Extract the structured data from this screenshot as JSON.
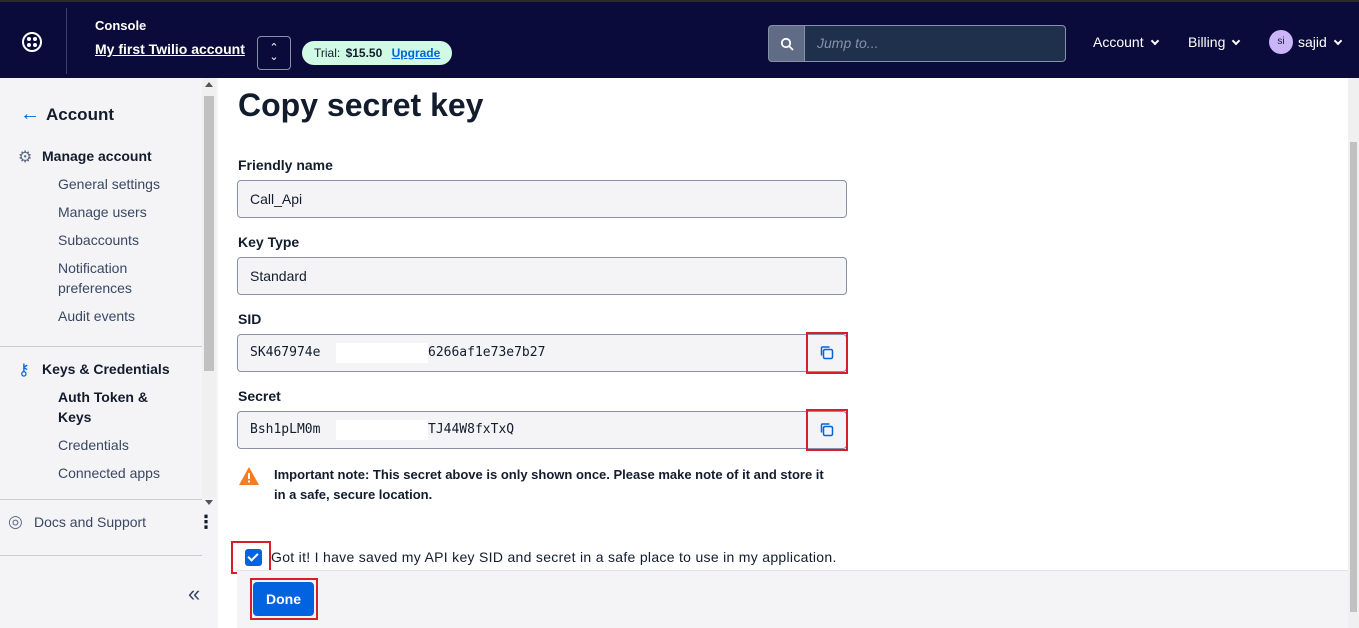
{
  "header": {
    "console_label": "Console",
    "account_name": "My first Twilio account",
    "trial_label": "Trial:",
    "trial_amount": "$15.50",
    "upgrade_label": "Upgrade",
    "search_placeholder": "Jump to...",
    "account_menu": "Account",
    "billing_menu": "Billing",
    "avatar_initials": "si",
    "user_name": "sajid"
  },
  "sidebar": {
    "back_label": "Account",
    "manage_account_section": "Manage account",
    "manage_items": [
      "General settings",
      "Manage users",
      "Subaccounts",
      "Notification preferences",
      "Audit events"
    ],
    "keys_section": "Keys & Credentials",
    "keys_items": [
      "Auth Token & Keys",
      "Credentials",
      "Connected apps"
    ],
    "docs_label": "Docs and Support",
    "collapse_icon": "double-chevron-left-icon"
  },
  "main": {
    "title": "Copy secret key",
    "friendly_name_label": "Friendly name",
    "friendly_name_value": "Call_Api",
    "key_type_label": "Key Type",
    "key_type_value": "Standard",
    "sid_label": "SID",
    "sid_value_start": "SK467974e",
    "sid_value_end": "6266af1e73e7b27",
    "secret_label": "Secret",
    "secret_value_start": "Bsh1pLM0m",
    "secret_value_end": "TJ44W8fxTxQ",
    "note": "Important note: This secret above is only shown once. Please make note of it and store it in a safe, secure location.",
    "checkbox_label": "Got it! I have saved my API key SID and secret in a safe place to use in my application.",
    "checkbox_checked": true,
    "done_label": "Done"
  },
  "colors": {
    "topbar": "#0b0b3b",
    "primary": "#0263e0",
    "highlight": "#d61f2c",
    "warning": "#f47c22"
  }
}
